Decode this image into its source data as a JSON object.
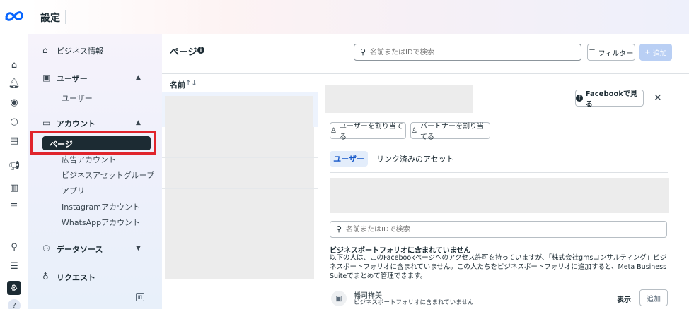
{
  "app": {
    "title": "設定"
  },
  "rail": {
    "icons": [
      "meta-logo",
      "home-icon",
      "bell-icon",
      "compass-icon",
      "circle-icon",
      "inbox-icon",
      "megaphone-icon",
      "analytics-icon",
      "menu-icon",
      "search-icon",
      "list-icon",
      "gear-icon",
      "help-icon"
    ]
  },
  "nav": {
    "business_info": "ビジネス情報",
    "users_section": "ユーザー",
    "users_item": "ユーザー",
    "accounts_section": "アカウント",
    "accounts_items": [
      "ページ",
      "広告アカウント",
      "ビジネスアセットグループ",
      "アプリ",
      "Instagramアカウント",
      "WhatsAppアカウント"
    ],
    "data_sources": "データソース",
    "requests": "リクエスト"
  },
  "main": {
    "page_title": "ページ",
    "search_placeholder": "名前またはIDで検索",
    "filter_label": "フィルター",
    "add_label": "追加",
    "column_name": "名前",
    "sort_icon": "↑↓"
  },
  "detail": {
    "view_on_facebook": "Facebookで見る",
    "assign_users": "ユーザーを割り当てる",
    "assign_partners": "パートナーを割り当てる",
    "tabs": [
      "ユーザー",
      "リンク済みのアセット"
    ],
    "search_placeholder": "名前またはIDで検索",
    "not_in_portfolio_title": "ビジネスポートフォリオに含まれていません",
    "not_in_portfolio_desc": "以下の人は、このFacebookページへのアクセス許可を持っていますが、「株式会社gmsコンサルティング」ビジネスポートフォリオに含まれていません。この人たちをビジネスポートフォリオに追加すると、Meta Business Suiteでまとめて管理できます。",
    "person": {
      "name": "幡司祥美",
      "status": "ビジネスポートフォリオに含まれていません",
      "view_label": "表示",
      "add_label": "追加"
    }
  }
}
